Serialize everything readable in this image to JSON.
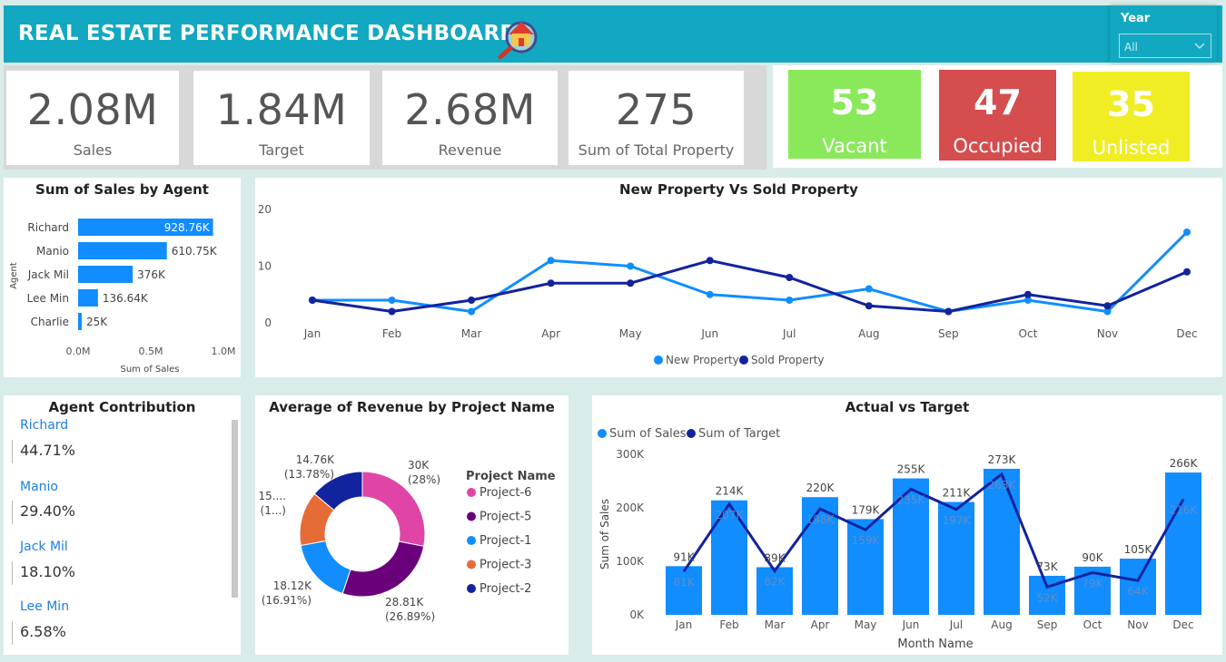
{
  "header": {
    "title": "REAL ESTATE PERFORMANCE DASHBOARD",
    "year_label": "Year",
    "year_value": "All"
  },
  "kpis": [
    {
      "value": "2.08M",
      "label": "Sales"
    },
    {
      "value": "1.84M",
      "label": "Target"
    },
    {
      "value": "2.68M",
      "label": "Revenue"
    },
    {
      "value": "275",
      "label": "Sum of Total Property"
    }
  ],
  "status": [
    {
      "value": "53",
      "label": "Vacant",
      "color": "#8ae95b"
    },
    {
      "value": "47",
      "label": "Occupied",
      "color": "#d54d4d"
    },
    {
      "value": "35",
      "label": "Unlisted",
      "color": "#f0ed25"
    }
  ],
  "colors": {
    "header": "#12a8c1",
    "bar": "#118dff",
    "dark_line": "#12239e",
    "light_line": "#118dff"
  },
  "sales_by_agent": {
    "title": "Sum of Sales by Agent",
    "y_label": "Agent",
    "x_label": "Sum of Sales",
    "x_ticks": [
      "0.0M",
      "0.5M",
      "1.0M"
    ],
    "chart_data": {
      "type": "bar",
      "orientation": "horizontal",
      "categories": [
        "Richard",
        "Manio",
        "Jack Mil",
        "Lee Min",
        "Charlie"
      ],
      "values": [
        928760,
        610750,
        376000,
        136640,
        25000
      ],
      "labels": [
        "928.76K",
        "610.75K",
        "376K",
        "136.64K",
        "25K"
      ],
      "xlim": [
        0,
        1000000
      ]
    }
  },
  "new_vs_sold": {
    "title": "New Property Vs Sold Property",
    "y_ticks": [
      "0",
      "10",
      "20"
    ],
    "chart_data": {
      "type": "line",
      "categories": [
        "Jan",
        "Feb",
        "Mar",
        "Apr",
        "May",
        "Jun",
        "Jul",
        "Aug",
        "Sep",
        "Oct",
        "Nov",
        "Dec"
      ],
      "ylim": [
        0,
        20
      ],
      "series": [
        {
          "name": "New Property",
          "values": [
            4,
            4,
            2,
            11,
            10,
            5,
            4,
            6,
            2,
            4,
            2,
            16
          ]
        },
        {
          "name": "Sold Property",
          "values": [
            4,
            2,
            4,
            7,
            7,
            11,
            8,
            3,
            2,
            5,
            3,
            9
          ]
        }
      ]
    }
  },
  "agent_contribution": {
    "title": "Agent Contribution",
    "items": [
      {
        "name": "Richard",
        "value": "44.71%"
      },
      {
        "name": "Manio",
        "value": "29.40%"
      },
      {
        "name": "Jack Mil",
        "value": "18.10%"
      },
      {
        "name": "Lee Min",
        "value": "6.58%"
      }
    ]
  },
  "revenue_by_project": {
    "title": "Average of Revenue by Project Name",
    "legend_title": "Project Name",
    "chart_data": {
      "type": "pie",
      "categories": [
        "Project-6",
        "Project-5",
        "Project-1",
        "Project-3",
        "Project-2"
      ],
      "values": [
        30000,
        28810,
        18120,
        15000,
        14760
      ],
      "colors": [
        "#e044a7",
        "#6b007b",
        "#118dff",
        "#e66c37",
        "#12239e"
      ],
      "labels": [
        [
          "30K",
          "(28%)"
        ],
        [
          "28.81K",
          "(26.89%)"
        ],
        [
          "18.12K",
          "(16.91%)"
        ],
        [
          "15....",
          "(1...)"
        ],
        [
          "14.76K",
          "(13.78%)"
        ]
      ]
    }
  },
  "actual_vs_target": {
    "title": "Actual vs Target",
    "y_label": "Sum of Sales",
    "x_label": "Month Name",
    "y_ticks": [
      "0K",
      "100K",
      "200K",
      "300K"
    ],
    "chart_data": {
      "type": "bar",
      "categories": [
        "Jan",
        "Feb",
        "Mar",
        "Apr",
        "May",
        "Jun",
        "Jul",
        "Aug",
        "Sep",
        "Oct",
        "Nov",
        "Dec"
      ],
      "ylim": [
        0,
        300000
      ],
      "series": [
        {
          "name": "Sum of Sales",
          "kind": "bar",
          "values": [
            91000,
            214000,
            89000,
            220000,
            179000,
            255000,
            211000,
            273000,
            73000,
            90000,
            105000,
            266000
          ],
          "labels": [
            "91K",
            "214K",
            "89K",
            "220K",
            "179K",
            "255K",
            "211K",
            "273K",
            "73K",
            "90K",
            "105K",
            "266K"
          ]
        },
        {
          "name": "Sum of Target",
          "kind": "line",
          "values": [
            81000,
            207000,
            82000,
            198000,
            159000,
            235000,
            197000,
            263000,
            52000,
            79000,
            64000,
            216000
          ],
          "labels": [
            "81K",
            "207K",
            "82K",
            "198K",
            "159K",
            "235K",
            "197K",
            "263K",
            "52K",
            "79K",
            "64K",
            "216K"
          ]
        }
      ]
    }
  }
}
